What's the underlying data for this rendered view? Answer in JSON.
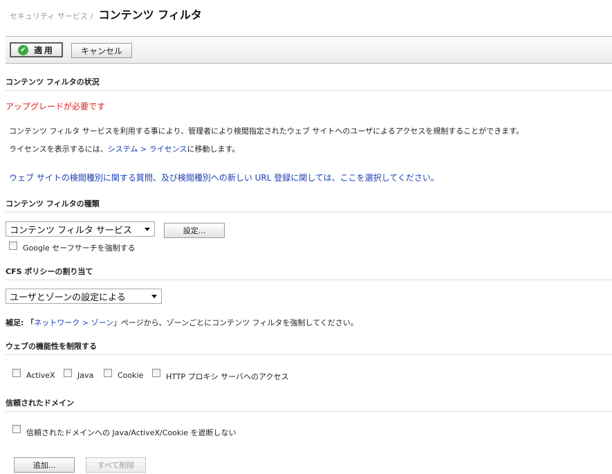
{
  "breadcrumb": {
    "parent": "セキュリティ サービス",
    "separator": "/",
    "title": "コンテンツ フィルタ"
  },
  "toolbar": {
    "apply_label": "適用",
    "cancel_label": "キャンセル"
  },
  "status_section": {
    "title": "コンテンツ フィルタの状況",
    "upgrade_notice": "アップグレードが必要です",
    "description": "コンテンツ フィルタ サービスを利用する事により、管理者により検閲指定されたウェブ サイトへのユーザによるアクセスを規制することができます。",
    "license_prefix": "ライセンスを表示するには、",
    "license_link": "システム > ライセンス",
    "license_suffix": "に移動します。",
    "category_link": "ウェブ サイトの検閲種別に関する質問、及び検閲種別への新しい URL 登録に関しては、ここを選択してください。"
  },
  "type_section": {
    "title": "コンテンツ フィルタの種類",
    "select_value": "コンテンツ フィルタ サービス",
    "settings_label": "設定...",
    "safesearch_label": "Google セーフサーチを強制する",
    "safesearch_checked": false
  },
  "policy_section": {
    "title": "CFS ポリシーの割り当て",
    "select_value": "ユーザとゾーンの設定による",
    "note_prefix": "補足: 「",
    "note_link": "ネットワーク > ゾーン",
    "note_suffix": "」ページから、ゾーンごとにコンテンツ フィルタを強制してください。"
  },
  "restrict_section": {
    "title": "ウェブの機能性を制限する",
    "options": [
      {
        "label": "ActiveX",
        "checked": false
      },
      {
        "label": "Java",
        "checked": false
      },
      {
        "label": "Cookie",
        "checked": false
      },
      {
        "label": "HTTP プロキシ サーバへのアクセス",
        "checked": false
      }
    ]
  },
  "trusted_section": {
    "title": "信頼されたドメイン",
    "option_label": "信頼されたドメインへの Java/ActiveX/Cookie を遮断しない",
    "option_checked": false,
    "add_label": "追加...",
    "delete_all_label": "すべて削除"
  },
  "colors": {
    "link": "#1a3fb5",
    "warning": "#e01a1a",
    "apply_icon": "#3ca63c"
  }
}
